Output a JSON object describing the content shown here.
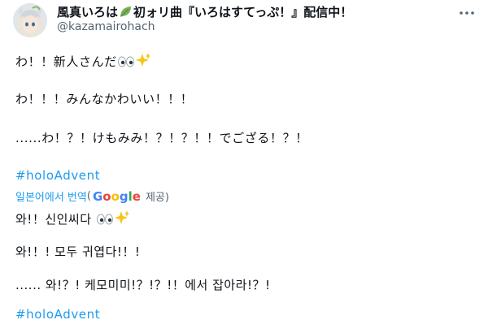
{
  "header": {
    "display_name_part1": "風真いろは",
    "display_name_part2": "初ォリ曲『いろはすてっぷ！』配信中！",
    "handle": "@kazamairohach",
    "name_icon": "leaf-icon",
    "more_icon": "more-options-icon"
  },
  "tweet": {
    "line1": "わ！！新人さんだ",
    "line2": "わ！！！みんなかわいい！！！",
    "line3": "......わ！？！けもみみ！？！？！！でござる！？！",
    "hashtag": "#holoAdvent"
  },
  "translation": {
    "link_label": "일본어에서 번역",
    "open_paren": "(",
    "google_G": "G",
    "google_o1": "o",
    "google_o2": "o",
    "google_g": "g",
    "google_l": "l",
    "google_e": "e",
    "provided_by": "제공)",
    "line1": "와!！신인씨다",
    "line2": "와!！! 모두 귀엽다!！!",
    "line3": "...... 와!？! 케모미미!？!？!！에서 잡아라!？!",
    "hashtag": "#holoAdvent"
  },
  "emojis": {
    "eyes": "eyes-emoji",
    "sparkles": "sparkles-emoji"
  },
  "colors": {
    "link": "#1d9bf0",
    "text": "#0f1419",
    "secondary": "#536471",
    "sparkle": "#f5c518",
    "leaf": "#78b159"
  }
}
